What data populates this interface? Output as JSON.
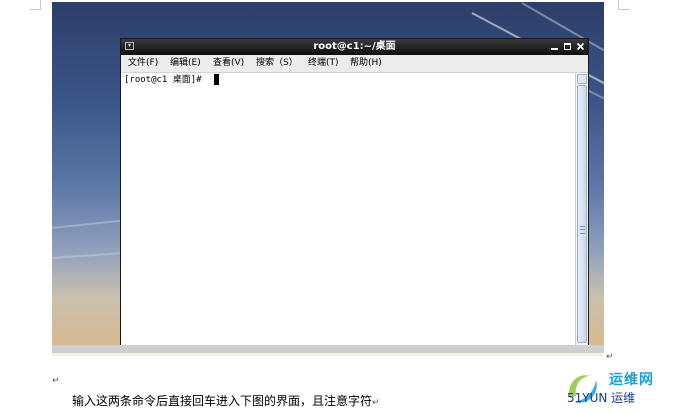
{
  "terminal": {
    "title": "root@c1:~/桌面",
    "menu": [
      "文件(F)",
      "编辑(E)",
      "查看(V)",
      "搜索（S）",
      "终端(T)",
      "帮助(H)"
    ],
    "prompt": "[root@c1 桌面]# "
  },
  "document": {
    "caption": "输入这两条命令后直接回车进入下图的界面，且注意字符",
    "paragraph_mark": "↵"
  },
  "watermark": {
    "main": "运维网",
    "sub": "51YUN 运维"
  },
  "colors": {
    "title_bar": "#0e0e0e",
    "menu_bar": "#ececec",
    "watermark_accent": "#1aa0d8"
  }
}
